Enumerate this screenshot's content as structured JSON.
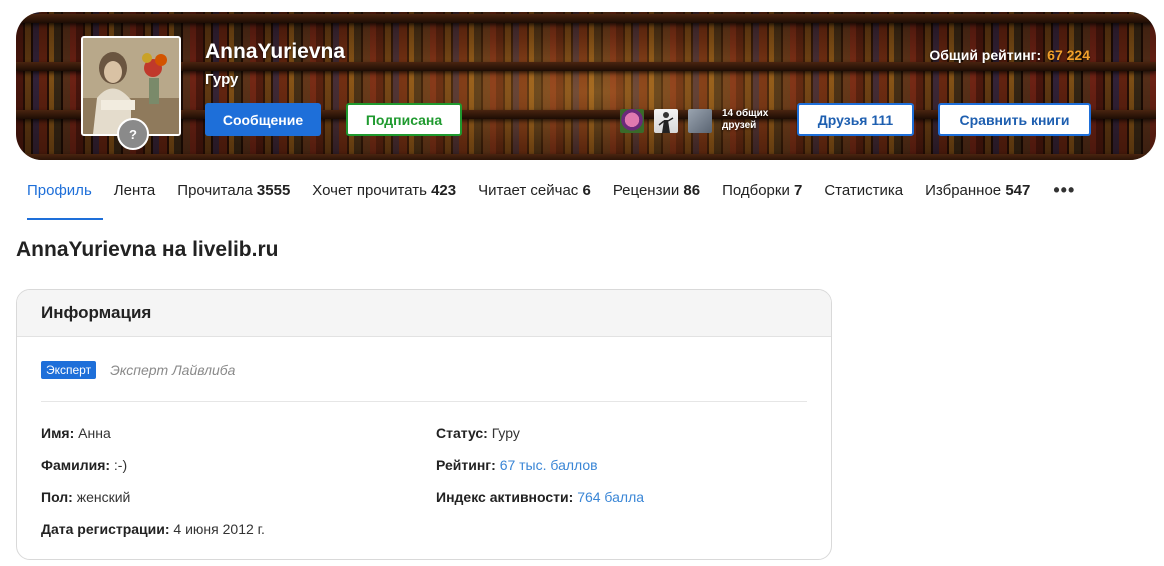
{
  "header": {
    "username": "AnnaYurievna",
    "level": "Гуру",
    "rating_label": "Общий рейтинг:",
    "rating_value": "67 224",
    "avatar_badge": "?",
    "buttons": {
      "message": "Сообщение",
      "subscribed": "Подписана",
      "friends": "Друзья 111",
      "compare": "Сравнить книги"
    },
    "common_friends_line1": "14 общих",
    "common_friends_line2": "друзей"
  },
  "tabs": [
    {
      "label": "Профиль",
      "count": ""
    },
    {
      "label": "Лента",
      "count": ""
    },
    {
      "label": "Прочитала",
      "count": "3555"
    },
    {
      "label": "Хочет прочитать",
      "count": "423"
    },
    {
      "label": "Читает сейчас",
      "count": "6"
    },
    {
      "label": "Рецензии",
      "count": "86"
    },
    {
      "label": "Подборки",
      "count": "7"
    },
    {
      "label": "Статистика",
      "count": ""
    },
    {
      "label": "Избранное",
      "count": "547"
    }
  ],
  "tabs_more": "•••",
  "page_heading": "AnnaYurievna на livelib.ru",
  "info": {
    "title": "Информация",
    "expert_badge": "Эксперт",
    "expert_text": "Эксперт Лайвлиба",
    "name_label": "Имя:",
    "name_value": "Анна",
    "surname_label": "Фамилия:",
    "surname_value": ":-)",
    "gender_label": "Пол:",
    "gender_value": "женский",
    "reg_label": "Дата регистрации:",
    "reg_value": "4 июня 2012 г.",
    "status_label": "Статус:",
    "status_value": "Гуру",
    "rating_label": "Рейтинг:",
    "rating_value": "67 тыс. баллов",
    "activity_label": "Индекс активности:",
    "activity_value": "764 балла"
  },
  "colors": {
    "accent": "#1e6fd9",
    "subscribed": "#1f9a2f",
    "rating_value": "#f2a12b",
    "link": "#3a86d6"
  }
}
